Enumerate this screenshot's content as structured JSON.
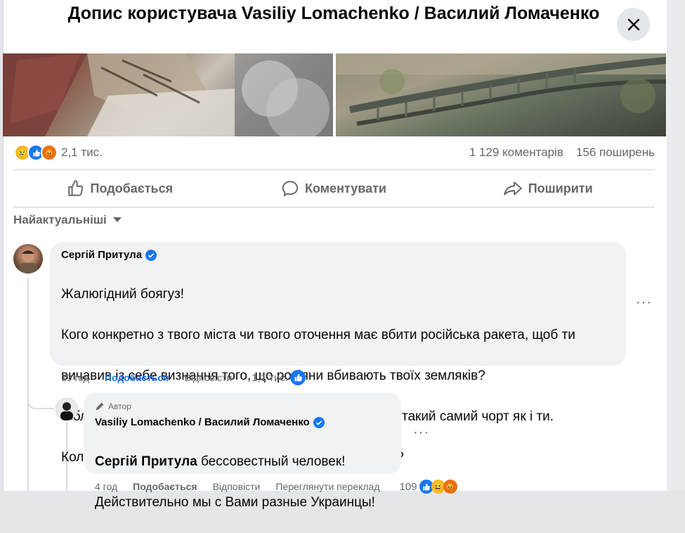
{
  "header": {
    "title": "Допис користувача Vasiliy Lomachenko / Василий Ломаченко"
  },
  "post": {
    "reaction_count": "2,1 тис.",
    "comments_count": "1 129 коментарів",
    "shares_count": "156 поширень"
  },
  "actions": {
    "like": "Подобається",
    "comment": "Коментувати",
    "share": "Поширити"
  },
  "sort_label": "Найактуальніші",
  "comments": [
    {
      "author": "Сергій Притула",
      "lines": [
        "Жалюгідний боягуз!",
        "Кого конкретно з твого міста чи твого оточення має вбити російська ракета, щоб ти",
        "вичавив із себе визнання того, що росіяни вбивають твоїх земляків?",
        "З благословення твого всратого патріарха кіріла! Який такий самий чорт як і ти.",
        "Коли ти вже напишеш заяву про вихід з громадянства?"
      ],
      "time": "19 год",
      "like": "Подобається",
      "reply": "Відповісти",
      "reactions": "1,1 тис."
    },
    {
      "badge": "Автор",
      "author": "Vasiliy Lomachenko / Василий Ломаченко",
      "mention": "Сергій Притула",
      "line1_rest": " бессовестный человек!",
      "line2": "Действительно мы с Вами разные Украинцы!",
      "time": "4 год",
      "like": "Подобається",
      "reply": "Відповісти",
      "translate": "Переглянути переклад",
      "reactions": "109"
    }
  ]
}
